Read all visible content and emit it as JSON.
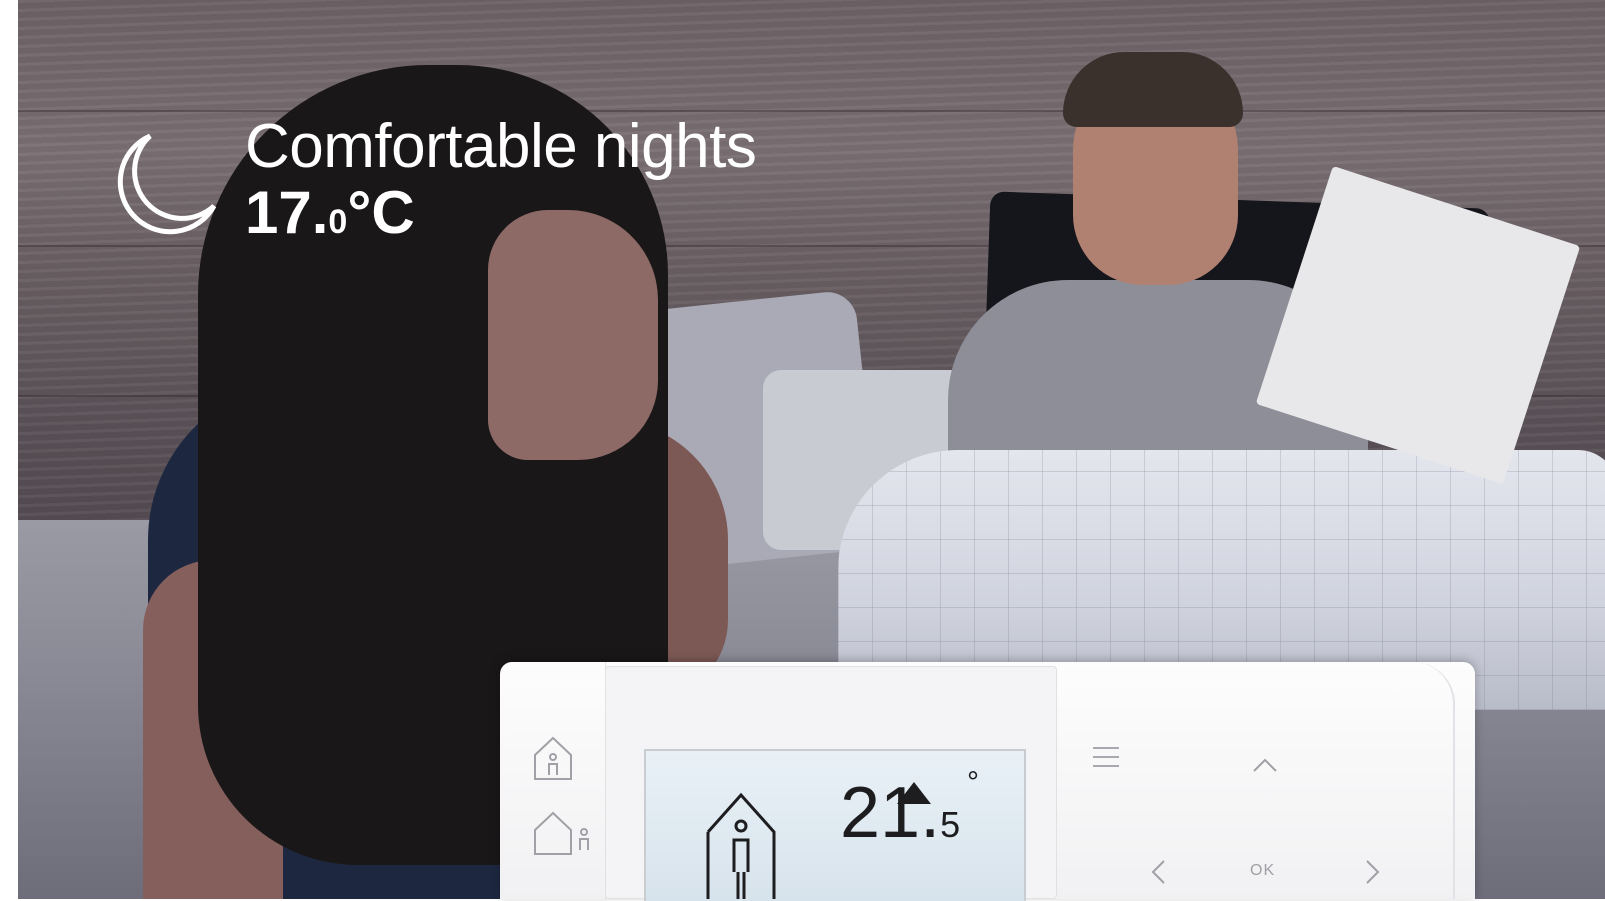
{
  "overlay": {
    "headline": "Comfortable nights",
    "temperature_main": "17.",
    "temperature_decimal": "0",
    "temperature_unit": "°C"
  },
  "thermostat": {
    "reading_main": "21.",
    "reading_decimal": "5",
    "reading_unit": "°",
    "ok_label": "OK"
  },
  "colors": {
    "overlay_text": "#ffffff",
    "device_body": "#f5f5f7",
    "screen": "#dde7ef"
  },
  "icons": [
    "moon-icon",
    "home-occupied-icon",
    "away-icon",
    "menu-icon",
    "chevron-up-icon",
    "chevron-left-icon",
    "chevron-right-icon",
    "screen-home-icon",
    "increase-arrow-icon"
  ]
}
